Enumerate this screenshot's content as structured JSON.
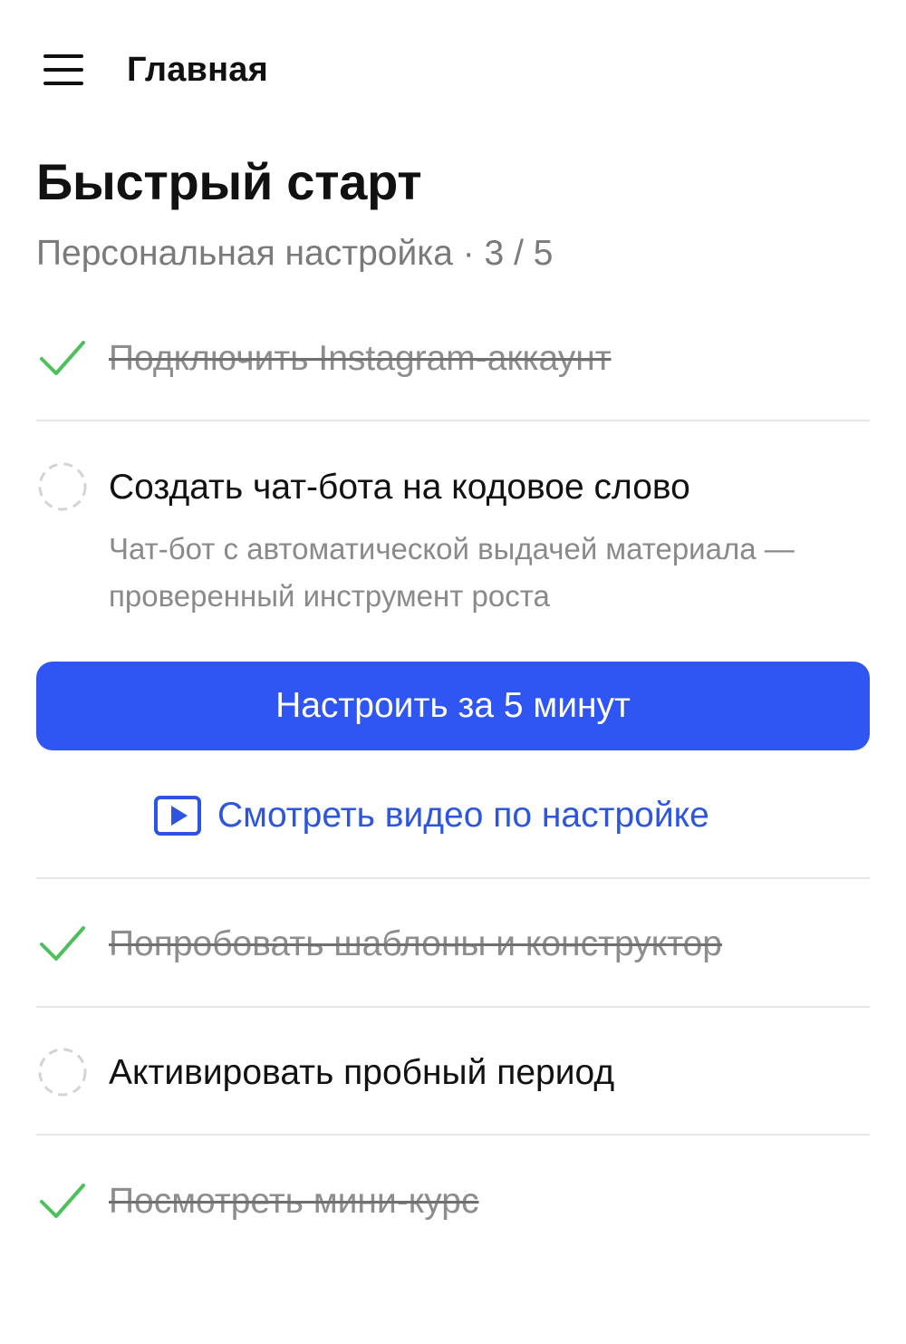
{
  "header": {
    "menu_icon": "hamburger-menu-icon",
    "title": "Главная"
  },
  "page": {
    "title": "Быстрый старт",
    "subtitle": "Персональная настройка · 3 / 5",
    "progress": {
      "completed": 3,
      "total": 5
    }
  },
  "tasks": [
    {
      "label": "Подключить Instagram-аккаунт",
      "status": "done"
    },
    {
      "label": "Создать чат-бота на кодовое слово",
      "status": "pending",
      "description": "Чат-бот с автоматической выдачей материала — проверенный инструмент роста",
      "primary_button": "Настроить за 5 минут",
      "video_link": "Смотреть видео по настройке"
    },
    {
      "label": "Попробовать шаблоны и конструктор",
      "status": "done"
    },
    {
      "label": "Активировать пробный период",
      "status": "pending"
    },
    {
      "label": "Посмотреть мини-курс",
      "status": "done"
    }
  ],
  "colors": {
    "accent": "#2f55f2",
    "link": "#2d55e0",
    "check": "#4cc05a",
    "muted_text": "#8a8a8a",
    "divider": "#e6e6e6"
  }
}
